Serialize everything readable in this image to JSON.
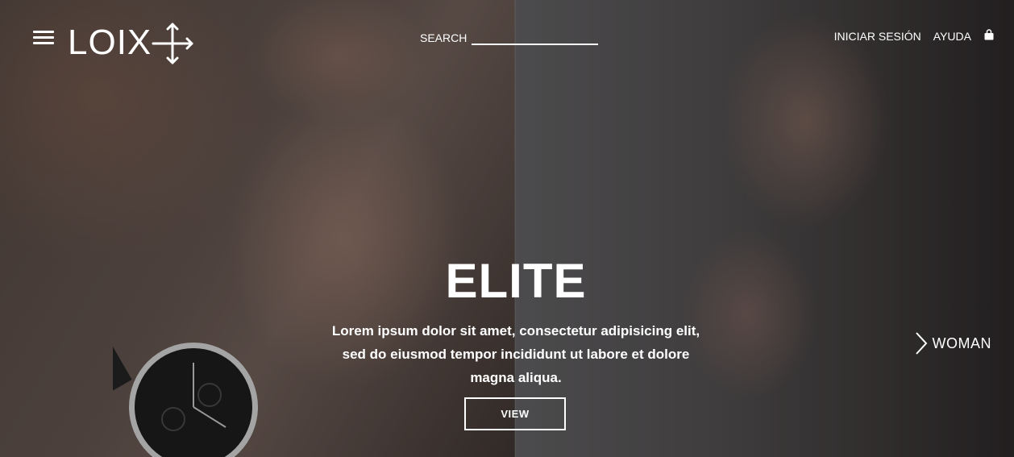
{
  "header": {
    "logo_text": "LOIX",
    "search_label": "SEARCH",
    "search_value": "",
    "nav": [
      "INICIAR SESIÓN",
      "AYUDA"
    ]
  },
  "hero": {
    "title": "ELITE",
    "text": "Lorem ipsum dolor sit amet, consectetur adipisicing elit, sed do eiusmod tempor incididunt ut labore et dolore magna aliqua.",
    "button_label": "VIEW",
    "next_label": "WOMAN"
  },
  "icons": {
    "menu": "hamburger-menu-icon",
    "logo_mark": "cross-arrows-icon",
    "bag": "shopping-bag-icon",
    "next": "chevron-right-icon"
  },
  "colors": {
    "text": "#ffffff",
    "overlay": "#000000"
  }
}
